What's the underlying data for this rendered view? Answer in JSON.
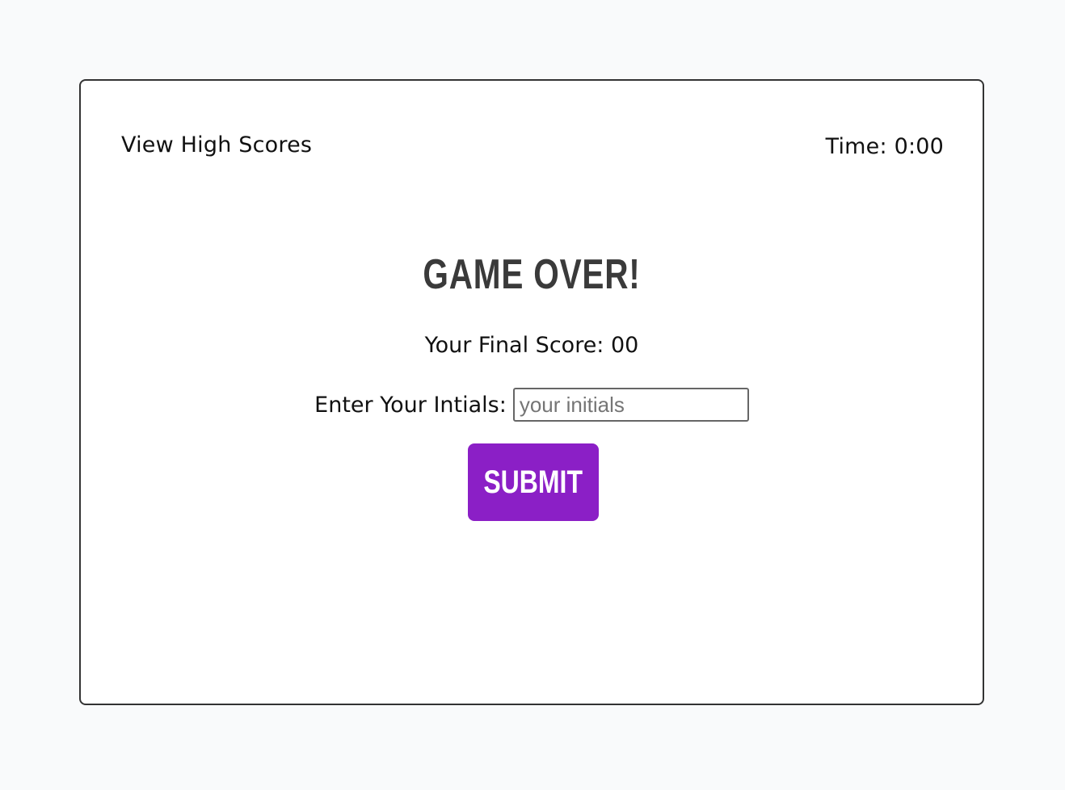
{
  "header": {
    "view_high_scores_label": "View High Scores",
    "timer_text": "Time: 0:00"
  },
  "main": {
    "title": "GAME OVER!",
    "final_score_text": "Your Final Score: 00",
    "initials_label": "Enter Your Intials:",
    "initials_placeholder": "your initials",
    "initials_value": "",
    "submit_label": "SUBMIT"
  },
  "colors": {
    "page_background": "#f9fafb",
    "card_background": "#ffffff",
    "card_border": "#333333",
    "title_color": "#3a3a3a",
    "submit_background": "#8b1fc6",
    "submit_text": "#ffffff"
  }
}
